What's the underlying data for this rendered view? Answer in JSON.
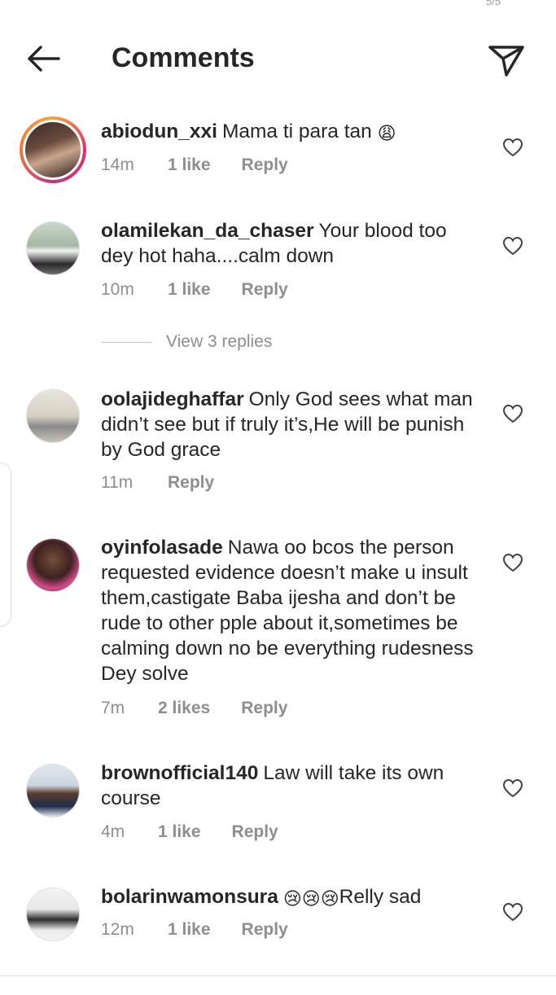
{
  "header": {
    "title": "Comments",
    "status_text": "5/5"
  },
  "comments": [
    {
      "username": "abiodun_xxi",
      "text": "Mama ti para tan",
      "emoji": "😩",
      "time": "14m",
      "likes": "1 like",
      "reply": "Reply",
      "avatar_style": "story"
    },
    {
      "username": "olamilekan_da_chaser",
      "text": "Your blood too dey hot haha....calm down",
      "time": "10m",
      "likes": "1 like",
      "reply": "Reply",
      "avatar_style": "plain"
    },
    {
      "username": "oolajideghaffar",
      "text": "Only God sees what man didn’t see but if truly it’s,He will be punish by God grace",
      "time": "11m",
      "likes": "",
      "reply": "Reply",
      "avatar_style": "plain"
    },
    {
      "username": "oyinfolasade",
      "text": "Nawa oo bcos the person requested evidence doesn’t make u insult them,castigate Baba ijesha and don’t be rude to other pple about it,sometimes be calming down no be everything rudesness Dey solve",
      "time": "7m",
      "likes": "2 likes",
      "reply": "Reply",
      "avatar_style": "plain"
    },
    {
      "username": "brownofficial140",
      "text": "Law will take its own course",
      "time": "4m",
      "likes": "1 like",
      "reply": "Reply",
      "avatar_style": "plain"
    },
    {
      "username": "bolarinwamonsura",
      "text": "Relly sad",
      "emoji": "😢😢😢",
      "time": "12m",
      "likes": "1 like",
      "reply": "Reply",
      "avatar_style": "plain"
    }
  ],
  "view_replies": "View 3 replies",
  "icons": {
    "back": "arrow-left-icon",
    "send": "paper-plane-icon",
    "like": "heart-outline-icon"
  },
  "colors": {
    "text": "#262626",
    "secondary": "#8e8e8e",
    "story_ring": "#e1306c"
  }
}
